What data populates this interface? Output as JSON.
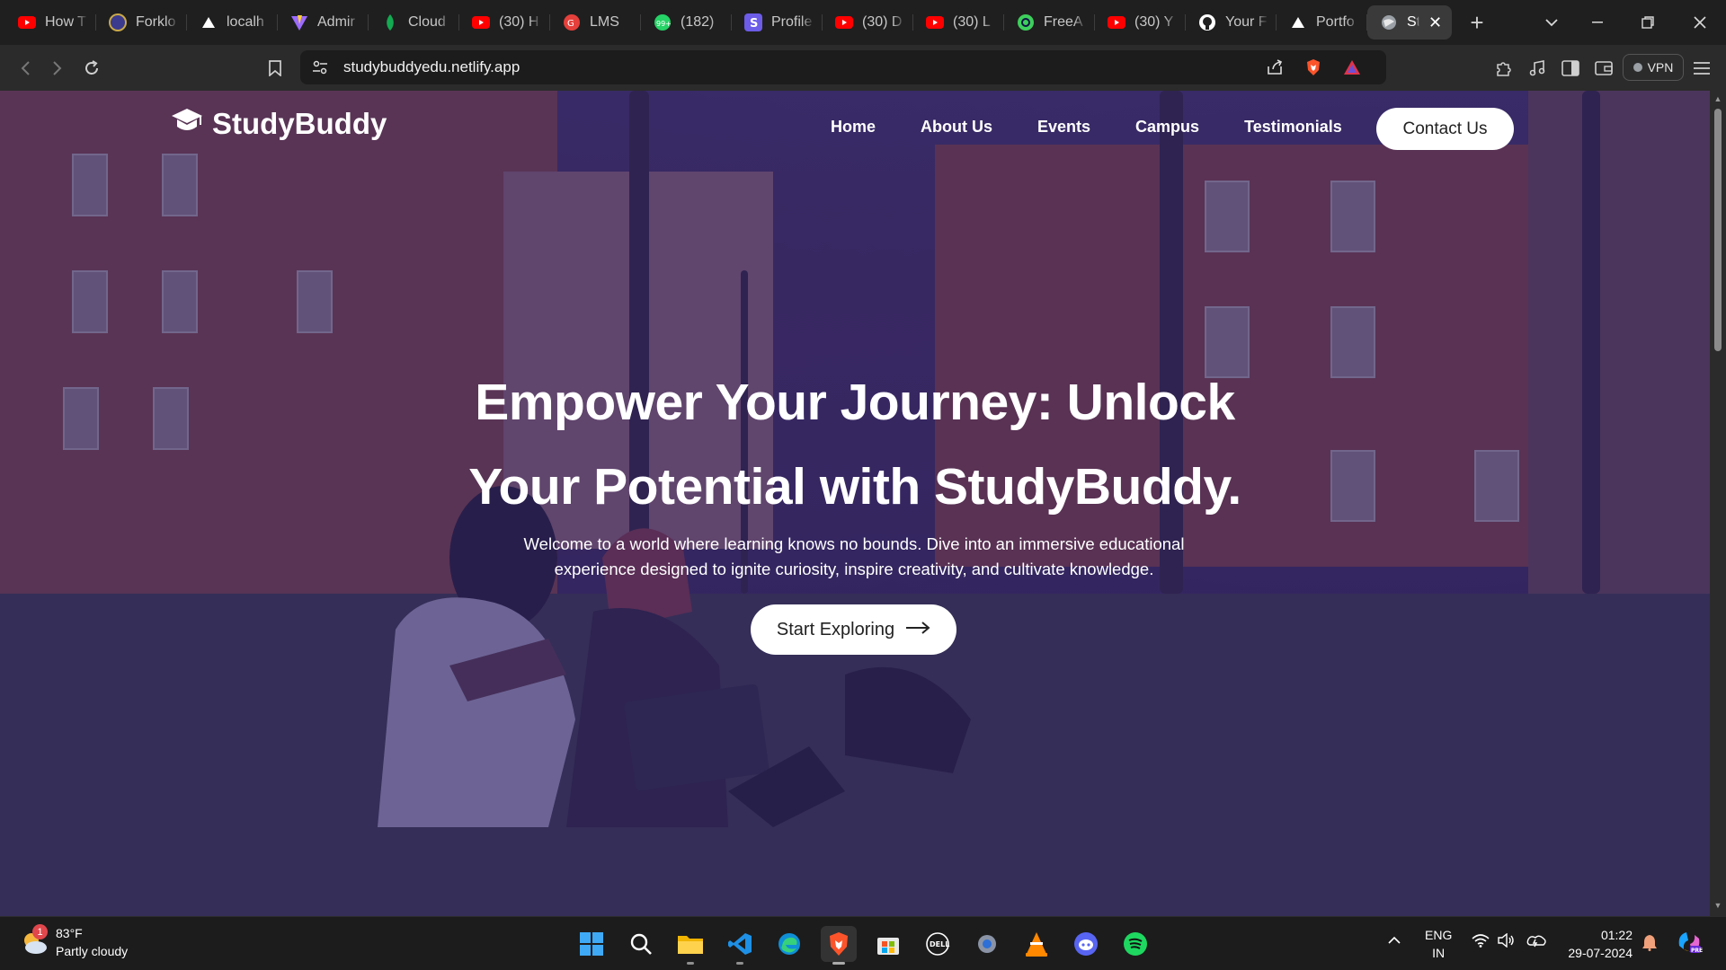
{
  "browser": {
    "tabs": [
      {
        "title": "How T",
        "icon": "youtube-icon"
      },
      {
        "title": "Forklo",
        "icon": "forklore-icon"
      },
      {
        "title": "localh",
        "icon": "vercel-icon"
      },
      {
        "title": "Admir",
        "icon": "vite-icon"
      },
      {
        "title": "Cloud",
        "icon": "mongodb-icon"
      },
      {
        "title": "(30) H",
        "icon": "youtube-icon"
      },
      {
        "title": "LMS",
        "icon": "lms-icon"
      },
      {
        "title": "(182) ",
        "icon": "whatsapp-icon"
      },
      {
        "title": "Profile",
        "icon": "profile-s-icon"
      },
      {
        "title": "(30) D",
        "icon": "youtube-icon"
      },
      {
        "title": "(30) L",
        "icon": "youtube-icon"
      },
      {
        "title": "FreeA",
        "icon": "freea-icon"
      },
      {
        "title": "(30) Y",
        "icon": "youtube-icon"
      },
      {
        "title": "Your F",
        "icon": "github-icon"
      },
      {
        "title": "Portfo",
        "icon": "vercel-icon"
      },
      {
        "title": "St",
        "icon": "globe-icon",
        "active": true
      }
    ],
    "new_tab": "+",
    "url": "studybuddyedu.netlify.app",
    "vpn_label": "VPN"
  },
  "site": {
    "brand": "StudyBuddy",
    "nav": [
      "Home",
      "About Us",
      "Events",
      "Campus",
      "Testimonials"
    ],
    "contact": "Contact Us",
    "hero_line1": "Empower Your Journey: Unlock",
    "hero_line2": "Your Potential with StudyBuddy.",
    "hero_sub_line1": "Welcome to a world where learning knows no bounds. Dive into an immersive educational",
    "hero_sub_line2": "experience designed to ignite curiosity, inspire creativity, and cultivate knowledge.",
    "cta": "Start Exploring",
    "overlay_color": "#32246e"
  },
  "taskbar": {
    "weather_badge": "1",
    "temp": "83°F",
    "condition": "Partly cloudy",
    "lang_line1": "ENG",
    "lang_line2": "IN",
    "time": "01:22",
    "date": "29-07-2024",
    "apps": [
      "windows-start-icon",
      "search-icon",
      "file-explorer-icon",
      "vscode-icon",
      "edge-icon",
      "brave-icon",
      "ms-store-icon",
      "dell-icon",
      "settings-icon",
      "vlc-icon",
      "discord-icon",
      "spotify-icon"
    ]
  }
}
